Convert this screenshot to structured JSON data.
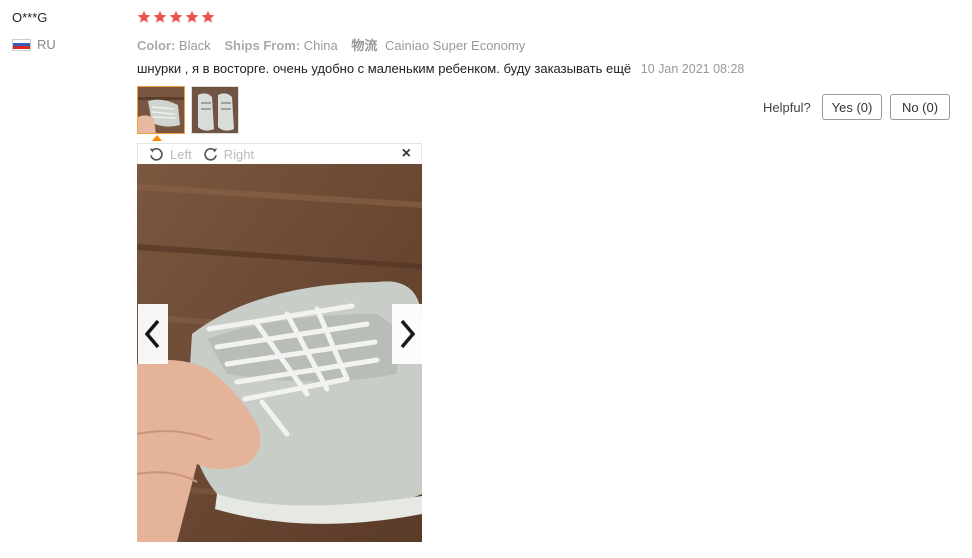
{
  "user": {
    "name": "O***G",
    "country": "RU"
  },
  "rating": {
    "stars": 5
  },
  "attributes": {
    "color_label": "Color:",
    "color_value": "Black",
    "ships_label": "Ships From:",
    "ships_value": "China",
    "logistics_label": "物流",
    "logistics_value": "Cainiao Super Economy"
  },
  "review": {
    "text": "шнурки , я в восторге. очень удобно с маленьким ребенком. буду заказывать ещё",
    "date": "10 Jan 2021 08:28"
  },
  "helpful": {
    "label": "Helpful?",
    "yes": "Yes (0)",
    "no": "No (0)"
  },
  "viewer": {
    "left_label": "Left",
    "right_label": "Right",
    "close": "×"
  },
  "colors": {
    "star": "#f0524f",
    "thumb_active_border": "#f0a040",
    "caret": "#ff8800"
  }
}
